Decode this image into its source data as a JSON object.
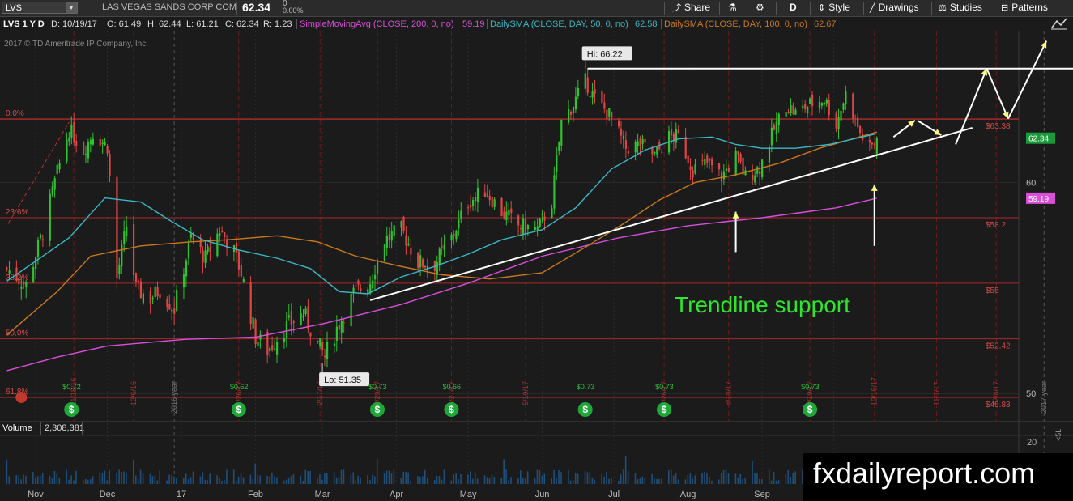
{
  "toolbar": {
    "symbol": "LVS",
    "company": "LAS VEGAS SANDS CORP COM",
    "last": "62.34",
    "change_pct": "0",
    "change_pct2": "0.00%",
    "share": "Share",
    "timeframe": "D",
    "style": "Style",
    "drawings": "Drawings",
    "studies": "Studies",
    "patterns": "Patterns",
    "icons": [
      "dropdown-icon",
      "share-icon",
      "flask-icon",
      "gear-icon",
      "style-icon",
      "drawings-icon",
      "studies-icon",
      "patterns-icon"
    ]
  },
  "studybar": {
    "title": "LVS 1 Y D",
    "date": "D: 10/19/17",
    "open": "O: 61.49",
    "high": "H: 62.44",
    "low": "L: 61.21",
    "close": "C: 62.34",
    "range": "R: 1.23",
    "sma200_label": "SimpleMovingAvg (CLOSE, 200, 0, no)",
    "sma200_val": "59.19",
    "sma50_label": "DailySMA (CLOSE, DAY, 50, 0, no)",
    "sma50_val": "62.58",
    "sma100_label": "DailySMA (CLOSE, DAY, 100, 0, no)",
    "sma100_val": "62.67"
  },
  "copyright": "2017 © TD Ameritrade IP Company, Inc.",
  "volume": {
    "label": "Volume",
    "value": "2,308,381",
    "axis_tick": "20",
    "axis_unit": "<5L"
  },
  "watermark": "fxdailyreport.com",
  "colors": {
    "bg": "#1b1b1b",
    "up": "#2fc42f",
    "down": "#e04545",
    "sma50": "#3bb7c4",
    "sma100": "#c8791e",
    "sma200": "#d94fd9",
    "fib": "#d23030",
    "annotation": "#ffffff",
    "annotation_text": "#2ee62e",
    "arrow": "#ffff66"
  },
  "chart_data": {
    "type": "candlestick",
    "symbol": "LVS",
    "ylim": [
      48.8,
      68.4
    ],
    "y_ticks": [
      50,
      60
    ],
    "x_labels": [
      "Nov",
      "Dec",
      "17",
      "Feb",
      "Mar",
      "Apr",
      "May",
      "Jun",
      "Jul",
      "Aug",
      "Sep",
      "O"
    ],
    "close_path": [
      [
        "2016-10-20",
        55.7
      ],
      [
        "2016-10-28",
        54.9
      ],
      [
        "2016-11-04",
        57.5
      ],
      [
        "2016-11-10",
        60.5
      ],
      [
        "2016-11-15",
        62.8
      ],
      [
        "2016-11-21",
        61.7
      ],
      [
        "2016-11-25",
        62.6
      ],
      [
        "2016-12-01",
        61.9
      ],
      [
        "2016-12-05",
        55.2
      ],
      [
        "2016-12-09",
        57.8
      ],
      [
        "2016-12-13",
        54.7
      ],
      [
        "2016-12-19",
        54.3
      ],
      [
        "2016-12-23",
        54.7
      ],
      [
        "2016-12-29",
        53.8
      ],
      [
        "2017-01-05",
        57.2
      ],
      [
        "2017-01-11",
        56.2
      ],
      [
        "2017-01-17",
        57.6
      ],
      [
        "2017-01-23",
        56.5
      ],
      [
        "2017-01-26",
        55.5
      ],
      [
        "2017-02-01",
        52.5
      ],
      [
        "2017-02-06",
        51.9
      ],
      [
        "2017-02-13",
        52.9
      ],
      [
        "2017-02-21",
        53.6
      ],
      [
        "2017-02-27",
        52.2
      ],
      [
        "2017-03-02",
        51.6
      ],
      [
        "2017-03-07",
        52.9
      ],
      [
        "2017-03-14",
        54.5
      ],
      [
        "2017-03-21",
        55.1
      ],
      [
        "2017-03-27",
        57.1
      ],
      [
        "2017-04-03",
        57.6
      ],
      [
        "2017-04-10",
        56.0
      ],
      [
        "2017-04-17",
        55.9
      ],
      [
        "2017-04-24",
        57.2
      ],
      [
        "2017-05-01",
        59.0
      ],
      [
        "2017-05-08",
        59.6
      ],
      [
        "2017-05-15",
        58.5
      ],
      [
        "2017-05-22",
        57.8
      ],
      [
        "2017-05-30",
        57.6
      ],
      [
        "2017-06-05",
        59.0
      ],
      [
        "2017-06-09",
        63.2
      ],
      [
        "2017-06-14",
        64.2
      ],
      [
        "2017-06-19",
        65.5
      ],
      [
        "2017-06-23",
        64.5
      ],
      [
        "2017-06-29",
        63.6
      ],
      [
        "2017-07-06",
        61.8
      ],
      [
        "2017-07-12",
        62.0
      ],
      [
        "2017-07-18",
        61.4
      ],
      [
        "2017-07-24",
        62.4
      ],
      [
        "2017-07-28",
        62.4
      ],
      [
        "2017-08-03",
        60.7
      ],
      [
        "2017-08-09",
        61.0
      ],
      [
        "2017-08-15",
        60.3
      ],
      [
        "2017-08-21",
        61.4
      ],
      [
        "2017-08-25",
        60.3
      ],
      [
        "2017-08-31",
        60.8
      ],
      [
        "2017-09-06",
        62.8
      ],
      [
        "2017-09-11",
        64.2
      ],
      [
        "2017-09-15",
        63.7
      ],
      [
        "2017-09-21",
        64.2
      ],
      [
        "2017-09-27",
        64.5
      ],
      [
        "2017-10-02",
        63.1
      ],
      [
        "2017-10-06",
        64.8
      ],
      [
        "2017-10-12",
        62.6
      ],
      [
        "2017-10-16",
        61.7
      ],
      [
        "2017-10-19",
        62.34
      ]
    ],
    "sma50": [
      [
        "2016-10-20",
        55.1
      ],
      [
        "2016-11-15",
        57.2
      ],
      [
        "2016-11-30",
        59.2
      ],
      [
        "2016-12-15",
        59.0
      ],
      [
        "2016-12-28",
        58.0
      ],
      [
        "2017-01-10",
        57.1
      ],
      [
        "2017-01-25",
        56.6
      ],
      [
        "2017-02-10",
        56.2
      ],
      [
        "2017-02-24",
        55.7
      ],
      [
        "2017-03-08",
        54.6
      ],
      [
        "2017-03-20",
        54.5
      ],
      [
        "2017-04-03",
        55.3
      ],
      [
        "2017-04-17",
        55.8
      ],
      [
        "2017-05-01",
        56.4
      ],
      [
        "2017-05-15",
        57.1
      ],
      [
        "2017-06-01",
        57.6
      ],
      [
        "2017-06-15",
        58.7
      ],
      [
        "2017-06-30",
        60.7
      ],
      [
        "2017-07-14",
        61.7
      ],
      [
        "2017-07-28",
        62.3
      ],
      [
        "2017-08-11",
        62.4
      ],
      [
        "2017-08-21",
        62.0
      ],
      [
        "2017-09-01",
        61.8
      ],
      [
        "2017-09-15",
        61.8
      ],
      [
        "2017-09-29",
        62.0
      ],
      [
        "2017-10-19",
        62.58
      ]
    ],
    "sma100": [
      [
        "2016-10-20",
        52.6
      ],
      [
        "2016-11-10",
        54.6
      ],
      [
        "2016-11-24",
        56.3
      ],
      [
        "2016-12-15",
        56.8
      ],
      [
        "2017-01-05",
        57.0
      ],
      [
        "2017-01-20",
        57.1
      ],
      [
        "2017-02-10",
        57.3
      ],
      [
        "2017-02-27",
        57.0
      ],
      [
        "2017-03-15",
        56.3
      ],
      [
        "2017-04-03",
        55.8
      ],
      [
        "2017-04-20",
        55.4
      ],
      [
        "2017-05-10",
        55.2
      ],
      [
        "2017-06-01",
        55.5
      ],
      [
        "2017-06-20",
        56.8
      ],
      [
        "2017-07-05",
        57.9
      ],
      [
        "2017-07-20",
        59.1
      ],
      [
        "2017-08-04",
        60.0
      ],
      [
        "2017-08-21",
        60.4
      ],
      [
        "2017-09-08",
        61.0
      ],
      [
        "2017-09-25",
        61.8
      ],
      [
        "2017-10-19",
        62.67
      ]
    ],
    "sma200": [
      [
        "2016-10-20",
        51.0
      ],
      [
        "2016-11-10",
        51.6
      ],
      [
        "2016-12-01",
        52.1
      ],
      [
        "2017-01-03",
        52.4
      ],
      [
        "2017-02-01",
        52.5
      ],
      [
        "2017-03-01",
        53.1
      ],
      [
        "2017-04-03",
        54.0
      ],
      [
        "2017-05-01",
        55.0
      ],
      [
        "2017-06-01",
        56.3
      ],
      [
        "2017-07-03",
        57.2
      ],
      [
        "2017-08-01",
        57.8
      ],
      [
        "2017-09-01",
        58.2
      ],
      [
        "2017-10-02",
        58.7
      ],
      [
        "2017-10-19",
        59.19
      ]
    ],
    "fib_levels": [
      {
        "label": "0.0%",
        "price": "$63.38",
        "value": 63.38
      },
      {
        "label": "23.6%",
        "price": "$58.2",
        "value": 58.2
      },
      {
        "label": "38.2%",
        "price": "$55",
        "value": 55.0
      },
      {
        "label": "50.0%",
        "price": "$52.42",
        "value": 52.42
      },
      {
        "label": "61.8%",
        "price": "$49.83",
        "value": 49.83
      }
    ],
    "hi": {
      "label": "Hi: 66.22",
      "date": "2017-06-19",
      "value": 66.22
    },
    "lo": {
      "label": "Lo: 51.35",
      "date": "2017-03-01",
      "value": 51.35
    },
    "right_labels": [
      {
        "text": "62.34",
        "value": 62.34,
        "color": "#1a9a3a"
      },
      {
        "text": "59.19",
        "value": 59.19,
        "color": "#d94fd9"
      }
    ],
    "events": [
      {
        "date": "2016-10-26",
        "type": "earnings",
        "label": "10/26"
      },
      {
        "date": "2016-11-16",
        "type": "dividend",
        "label": "$0.72"
      },
      {
        "date": "2016-11-17",
        "type": "date",
        "label": "11/18/16"
      },
      {
        "date": "2016-12-12",
        "type": "date",
        "label": "12/6/16"
      },
      {
        "date": "2017-01-25",
        "type": "dividend",
        "label": "$0.62"
      },
      {
        "date": "2017-01-25",
        "type": "date",
        "label": "1/26/17"
      },
      {
        "date": "2017-02-28",
        "type": "date",
        "label": "2/17/17"
      },
      {
        "date": "2017-03-24",
        "type": "dividend",
        "label": "$0.73"
      },
      {
        "date": "2017-03-24",
        "type": "date",
        "label": "3/29/17"
      },
      {
        "date": "2017-04-24",
        "type": "dividend",
        "label": "$0.66"
      },
      {
        "date": "2017-04-24",
        "type": "date",
        "label": "4/27/17"
      },
      {
        "date": "2017-05-25",
        "type": "date",
        "label": "5/19/17"
      },
      {
        "date": "2017-06-19",
        "type": "dividend",
        "label": "$0.73"
      },
      {
        "date": "2017-07-22",
        "type": "dividend",
        "label": "$0.73"
      },
      {
        "date": "2017-07-22",
        "type": "date",
        "label": "7/26/17"
      },
      {
        "date": "2017-08-18",
        "type": "date",
        "label": "8/18/17"
      },
      {
        "date": "2017-09-21",
        "type": "dividend",
        "label": "$0.73"
      },
      {
        "date": "2017-09-21",
        "type": "date",
        "label": "9/19/17"
      },
      {
        "date": "2017-10-18",
        "type": "date",
        "label": "10/18/17"
      },
      {
        "date": "2017-11-13",
        "type": "date",
        "label": "11/7/17"
      },
      {
        "date": "2017-12-08",
        "type": "date",
        "label": "12/8/17"
      }
    ],
    "year_labels": [
      {
        "date": "2016-12-29",
        "label": "2016 year"
      },
      {
        "date": "2017-12-28",
        "label": "2017 year"
      }
    ],
    "annotation": {
      "text": "Trendline support"
    }
  }
}
